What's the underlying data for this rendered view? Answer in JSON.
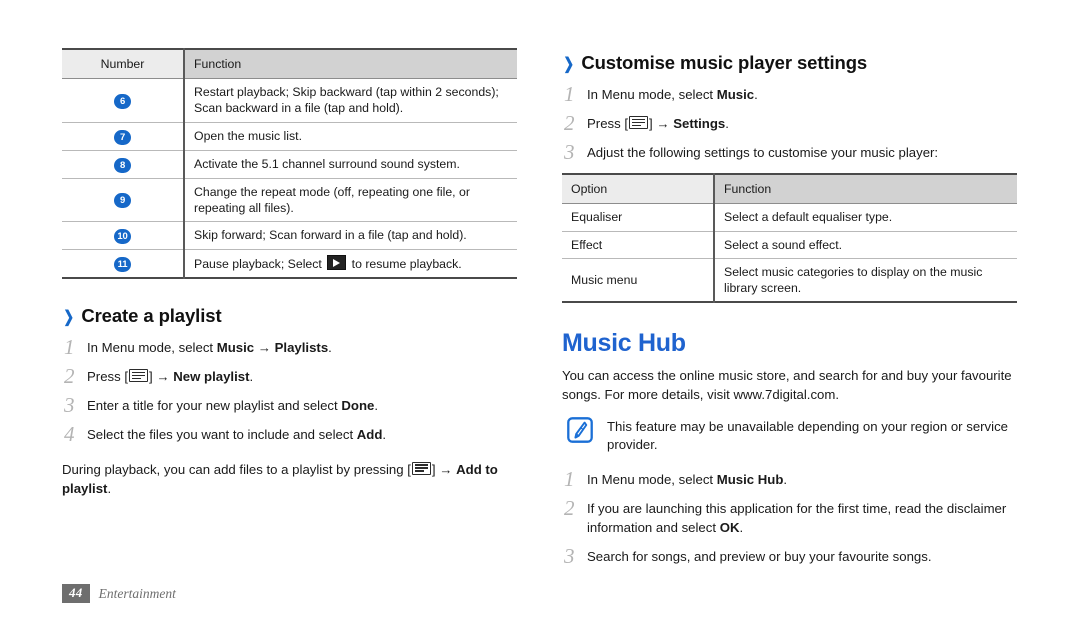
{
  "left_column": {
    "number_table": {
      "headers": [
        "Number",
        "Function"
      ],
      "rows": [
        {
          "number": "6",
          "function": "Restart playback; Skip backward (tap within 2 seconds); Scan backward in a file (tap and hold)."
        },
        {
          "number": "7",
          "function": "Open the music list."
        },
        {
          "number": "8",
          "function": "Activate the 5.1 channel surround sound system."
        },
        {
          "number": "9",
          "function": "Change the repeat mode (off, repeating one file, or repeating all files)."
        },
        {
          "number": "10",
          "function": "Skip forward; Scan forward in a file (tap and hold)."
        },
        {
          "number": "11",
          "function_pre": "Pause playback; Select ",
          "function_post": " to resume playback."
        }
      ]
    },
    "create_playlist": {
      "heading": "Create a playlist",
      "chevron": "chevron-right-icon",
      "steps": [
        {
          "num": "1",
          "pre": "In Menu mode, select ",
          "bold1": "Music",
          "mid": " → ",
          "bold2": "Playlists",
          "post": "."
        },
        {
          "num": "2",
          "pre": "Press [",
          "key": "menu-key-icon",
          "mid": "] → ",
          "bold2": "New playlist",
          "post": "."
        },
        {
          "num": "3",
          "pre": "Enter a title for your new playlist and select ",
          "bold2": "Done",
          "post": "."
        },
        {
          "num": "4",
          "pre": "Select the files you want to include and select ",
          "bold2": "Add",
          "post": "."
        }
      ],
      "note_paragraph": {
        "pre": "During playback, you can add files to a playlist by pressing [",
        "key": "menu-key-icon",
        "mid": "] → ",
        "bold": "Add to playlist",
        "post": "."
      }
    }
  },
  "right_column": {
    "customise_settings": {
      "heading": "Customise music player settings",
      "chevron": "chevron-right-icon",
      "steps": [
        {
          "num": "1",
          "pre": "In Menu mode, select ",
          "bold2": "Music",
          "post": "."
        },
        {
          "num": "2",
          "pre": "Press [",
          "key": "menu-key-icon",
          "mid": "] → ",
          "bold2": "Settings",
          "post": "."
        },
        {
          "num": "3",
          "pre": "Adjust the following settings to customise your music player:",
          "bold2": "",
          "post": ""
        }
      ],
      "option_table": {
        "headers": [
          "Option",
          "Function"
        ],
        "rows": [
          {
            "option": "Equaliser",
            "function": "Select a default equaliser type."
          },
          {
            "option": "Effect",
            "function": "Select a sound effect."
          },
          {
            "option": "Music menu",
            "function": "Select music categories to display on the music library screen."
          }
        ]
      }
    },
    "music_hub": {
      "heading": "Music Hub",
      "intro": "You can access the online music store, and search for and buy your favourite songs. For more details, visit www.7digital.com.",
      "note": {
        "icon": "note-pen-icon",
        "text": "This feature may be unavailable depending on your region or service provider."
      },
      "steps": [
        {
          "num": "1",
          "pre": "In Menu mode, select ",
          "bold2": "Music Hub",
          "post": "."
        },
        {
          "num": "2",
          "pre": "If you are launching this application for the first time, read the disclaimer information and select ",
          "bold2": "OK",
          "post": "."
        },
        {
          "num": "3",
          "pre": "Search for songs, and preview or buy your favourite songs.",
          "bold2": "",
          "post": ""
        }
      ]
    }
  },
  "footer": {
    "page_number": "44",
    "chapter": "Entertainment"
  },
  "colors": {
    "accent_blue": "#1668c8",
    "hub_blue": "#1f63cf",
    "number_badge": "#1668c8",
    "table_header_light": "#ececec",
    "table_header_dark": "#d2d2d2",
    "step_number_gray": "#b4b4b4",
    "footer_gray": "#6e6e6e"
  }
}
